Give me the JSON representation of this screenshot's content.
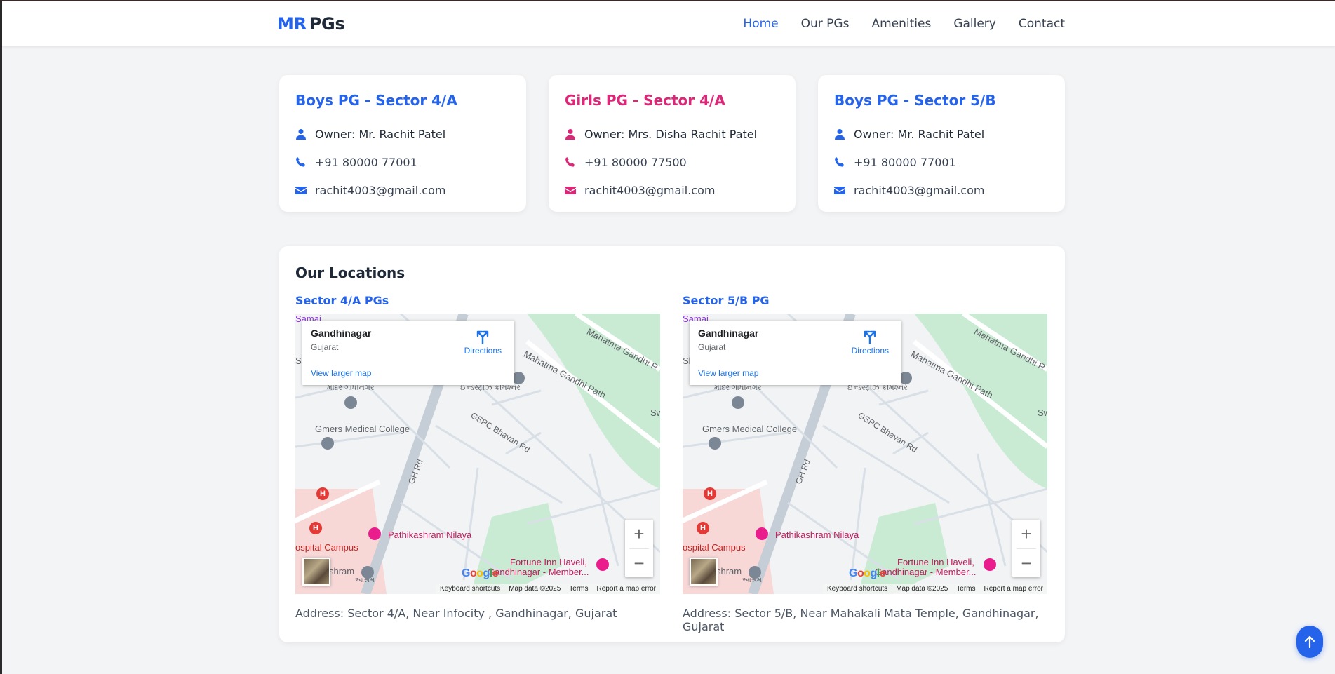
{
  "brand": {
    "part1": "MR",
    "part2": "PGs"
  },
  "nav": {
    "home": "Home",
    "our_pgs": "Our PGs",
    "amenities": "Amenities",
    "gallery": "Gallery",
    "contact": "Contact"
  },
  "cards": [
    {
      "title": "Boys PG - Sector 4/A",
      "owner": "Owner: Mr. Rachit Patel",
      "phone": "+91 80000 77001",
      "email": "rachit4003@gmail.com",
      "accent": "#2563eb"
    },
    {
      "title": "Girls PG - Sector 4/A",
      "owner": "Owner: Mrs. Disha Rachit Patel",
      "phone": "+91 80000 77500",
      "email": "rachit4003@gmail.com",
      "accent": "#db2777"
    },
    {
      "title": "Boys PG - Sector 5/B",
      "owner": "Owner: Mr. Rachit Patel",
      "phone": "+91 80000 77001",
      "email": "rachit4003@gmail.com",
      "accent": "#2563eb"
    }
  ],
  "locations": {
    "heading": "Our Locations",
    "items": [
      {
        "label": "Sector 4/A PGs",
        "address": "Address: Sector 4/A, Near Infocity , Gandhinagar, Gujarat"
      },
      {
        "label": "Sector 5/B PG",
        "address": "Address: Sector 5/B, Near Mahakali Mata Temple, Gandhinagar, Gujarat"
      }
    ]
  },
  "map": {
    "place": "Gandhinagar",
    "state": "Gujarat",
    "directions": "Directions",
    "view_larger": "View larger map",
    "labels": {
      "samaj": "Samaj",
      "sh": "Sh",
      "mandir": "મંદિર ગાંધીનગર",
      "commissioner": "ઈન્ડસ્ટ્રીઝ કમિશ્નર",
      "gmers": "Gmers Medical College",
      "gh_rd": "GH Rd",
      "gspc": "GSPC Bhavan Rd",
      "mg_path": "Mahatma Gandhi Path",
      "mg_road": "Mahatma Gandhi R",
      "sw": "Sw",
      "campus": "ospital Campus",
      "pathik": "Pathikashram Nilaya",
      "fortune1": "Fortune Inn Haveli,",
      "fortune2": "Gandhinagar - Member...",
      "ashram": "shram",
      "ashram_guj": "આશ્રમ",
      "hospital_marker": "H"
    },
    "attribution": {
      "shortcuts": "Keyboard shortcuts",
      "data": "Map data ©2025",
      "terms": "Terms",
      "report": "Report a map error"
    },
    "google": [
      "G",
      "o",
      "o",
      "g",
      "l",
      "e"
    ],
    "zoom_in": "+",
    "zoom_out": "−"
  },
  "icons": {
    "owner": "user-icon",
    "phone": "phone-icon",
    "email": "envelope-icon",
    "back_to_top": "arrow-up-icon"
  }
}
